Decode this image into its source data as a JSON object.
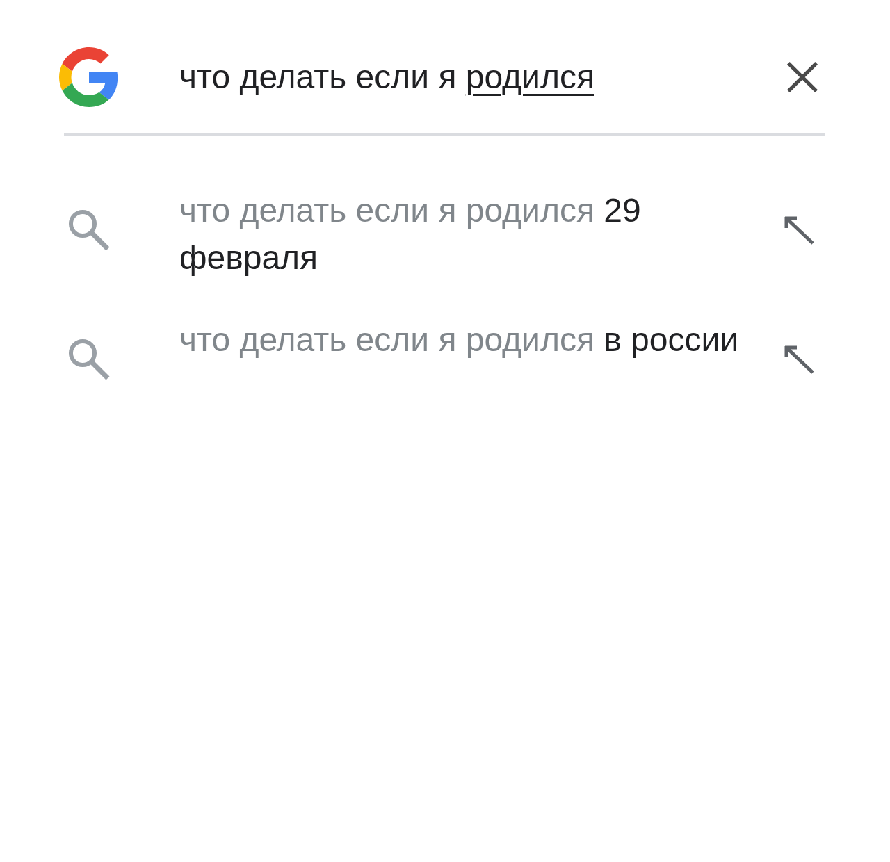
{
  "search": {
    "committed": "что делать если я",
    "composing": "родился"
  },
  "suggestions": [
    {
      "matched": "что делать если я родился",
      "completion": "29 февраля"
    },
    {
      "matched": "что делать если я родился",
      "completion": "в россии"
    }
  ]
}
